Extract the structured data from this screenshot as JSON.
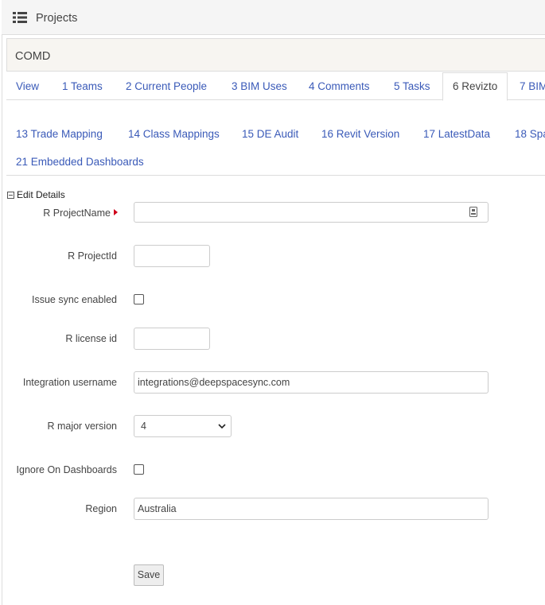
{
  "header": {
    "title": "Projects",
    "icon": "list-icon"
  },
  "panel": {
    "title": "COMD"
  },
  "tabs": {
    "row1": [
      "View",
      "1 Teams",
      "2 Current People",
      "3 BIM Uses",
      "4 Comments",
      "5 Tasks",
      "6 Revizto",
      "7 BIM"
    ],
    "row2": [
      "13 Trade Mapping",
      "14 Class Mappings",
      "15 DE Audit",
      "16 Revit Version",
      "17 LatestData",
      "18 Spa"
    ],
    "row3": [
      "21 Embedded Dashboards"
    ],
    "active": "6 Revizto"
  },
  "form": {
    "legend": "Edit Details",
    "fields": {
      "project_name": {
        "label": "R ProjectName",
        "value": ""
      },
      "project_id": {
        "label": "R ProjectId",
        "value": ""
      },
      "issue_sync": {
        "label": "Issue sync enabled",
        "checked": false
      },
      "license_id": {
        "label": "R license id",
        "value": ""
      },
      "integration_username": {
        "label": "Integration username",
        "value": "integrations@deepspacesync.com"
      },
      "major_version": {
        "label": "R major version",
        "value": "4"
      },
      "ignore_dashboards": {
        "label": "Ignore On Dashboards",
        "checked": false
      },
      "region": {
        "label": "Region",
        "value": "Australia"
      }
    },
    "save_label": "Save"
  },
  "colors": {
    "link": "#3a5ab8",
    "required": "#d0021b"
  }
}
